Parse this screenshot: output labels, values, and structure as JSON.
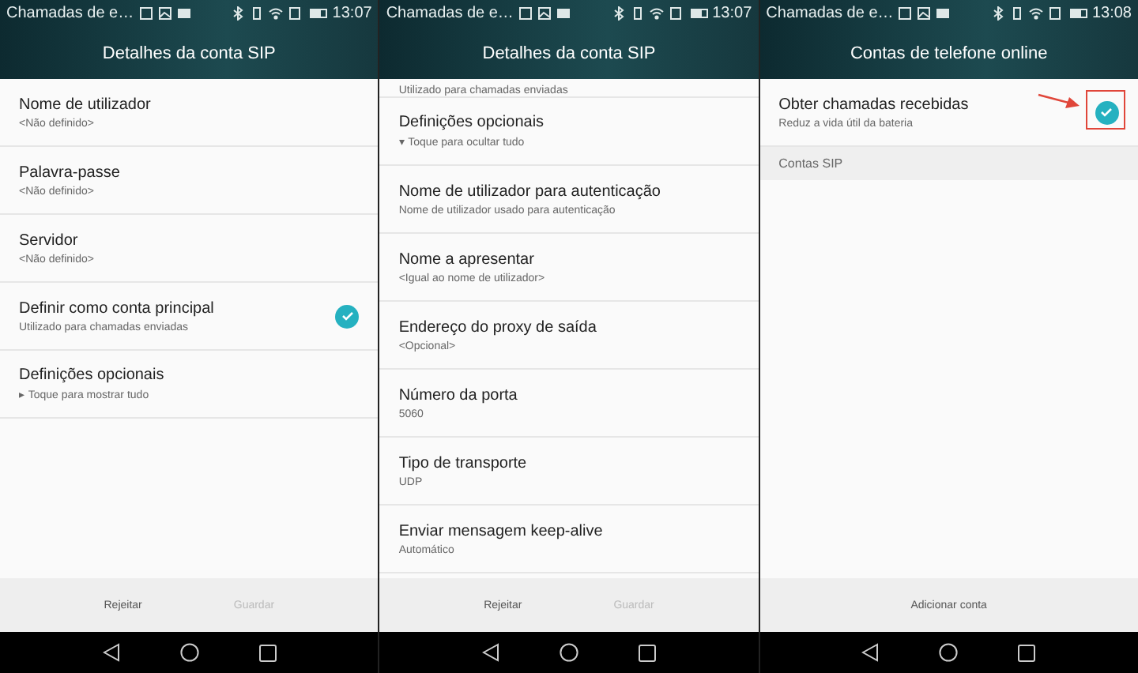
{
  "phones": [
    {
      "status": {
        "title": "Chamadas de e…",
        "time": "13:07"
      },
      "header": "Detalhes da conta SIP",
      "rows": [
        {
          "kind": "pref",
          "title": "Nome de utilizador",
          "summary": "<Não definido>"
        },
        {
          "kind": "pref",
          "title": "Palavra-passe",
          "summary": "<Não definido>"
        },
        {
          "kind": "pref",
          "title": "Servidor",
          "summary": "<Não definido>"
        },
        {
          "kind": "check",
          "title": "Definir como conta principal",
          "summary": "Utilizado para chamadas enviadas",
          "checked": true,
          "highlighted": false
        },
        {
          "kind": "pref",
          "title": "Definições opcionais",
          "summary": "▸ Toque para mostrar tudo"
        }
      ],
      "actions": [
        {
          "label": "Rejeitar",
          "disabled": false
        },
        {
          "label": "Guardar",
          "disabled": true
        }
      ]
    },
    {
      "status": {
        "title": "Chamadas de e…",
        "time": "13:07"
      },
      "header": "Detalhes da conta SIP",
      "rows": [
        {
          "kind": "cutoff",
          "summary": "Utilizado para chamadas enviadas"
        },
        {
          "kind": "pref",
          "title": "Definições opcionais",
          "summary": "▾ Toque para ocultar tudo"
        },
        {
          "kind": "pref",
          "title": "Nome de utilizador para autenticação",
          "summary": "Nome de utilizador usado para autenticação"
        },
        {
          "kind": "pref",
          "title": "Nome a apresentar",
          "summary": "<Igual ao nome de utilizador>"
        },
        {
          "kind": "pref",
          "title": "Endereço do proxy de saída",
          "summary": "<Opcional>"
        },
        {
          "kind": "pref",
          "title": "Número da porta",
          "summary": "5060"
        },
        {
          "kind": "pref",
          "title": "Tipo de transporte",
          "summary": "UDP"
        },
        {
          "kind": "pref",
          "title": "Enviar mensagem keep-alive",
          "summary": "Automático"
        }
      ],
      "actions": [
        {
          "label": "Rejeitar",
          "disabled": false
        },
        {
          "label": "Guardar",
          "disabled": true
        }
      ]
    },
    {
      "status": {
        "title": "Chamadas de e…",
        "time": "13:08"
      },
      "header": "Contas de telefone online",
      "rows": [
        {
          "kind": "check",
          "title": "Obter chamadas recebidas",
          "summary": "Reduz a vida útil da bateria",
          "checked": true,
          "highlighted": true
        },
        {
          "kind": "section",
          "title": "Contas SIP"
        }
      ],
      "actions": [
        {
          "label": "Adicionar conta",
          "disabled": false
        }
      ]
    }
  ]
}
